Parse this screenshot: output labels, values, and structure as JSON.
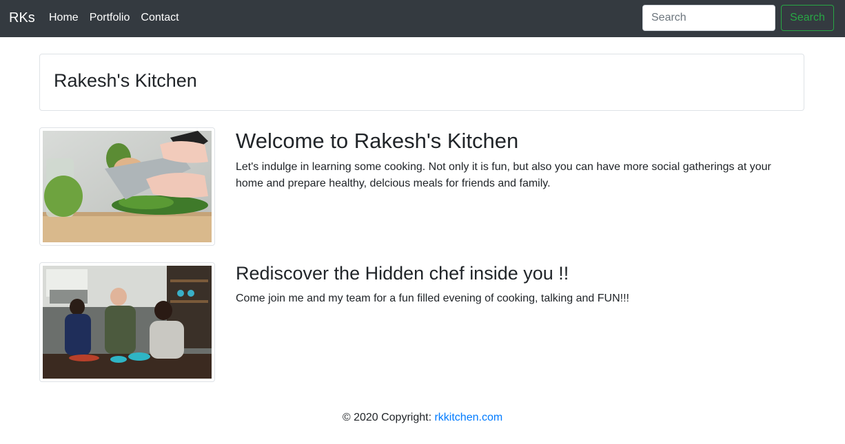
{
  "navbar": {
    "brand": "RKs",
    "links": [
      "Home",
      "Portfolio",
      "Contact"
    ],
    "search_placeholder": "Search",
    "search_button": "Search"
  },
  "header": {
    "title": "Rakesh's Kitchen"
  },
  "media": [
    {
      "image": "cooking-chopping-herbs-photo",
      "title": "Welcome to Rakesh's Kitchen",
      "text": "Let's indulge in learning some cooking. Not only it is fun, but also you can have more social gatherings at your home and prepare healthy, delcious meals for friends and family."
    },
    {
      "image": "people-cooking-together-photo",
      "title": "Rediscover the Hidden chef inside you !!",
      "text": "Come join me and my team for a fun filled evening of cooking, talking and FUN!!!"
    }
  ],
  "footer": {
    "copyright": "© 2020 Copyright: ",
    "link": "rkkitchen.com"
  },
  "colors": {
    "navbar_bg": "#343a40",
    "success": "#28a745",
    "link": "#007bff"
  }
}
